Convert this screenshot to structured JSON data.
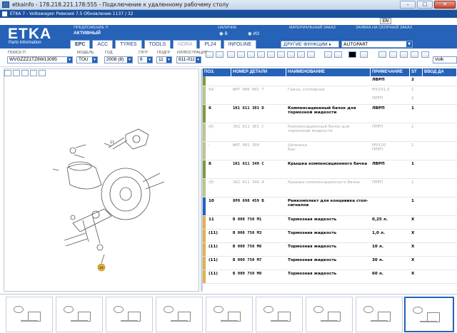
{
  "window": {
    "title": "etkainfo - 178.218.221.178:555 - Подключение к удаленному рабочему столу",
    "app_title": "ETKA 7 - Volkswagen Ревизия 7.5 Обновление 1137 / 32",
    "minimize_label": "–",
    "maximize_label": "□",
    "close_label": "✕",
    "language": "EN"
  },
  "header": {
    "logo": "ETKA",
    "logo_sub": "Parts Information",
    "offer_label": "ПРЕДЛОЖЕНИЕ П",
    "offer_value": "АКТИВНЫЙ",
    "availability_label": "НАЛИЧИЕ",
    "availability_b": "◉ В",
    "availability_iz": "◉ ИЗ",
    "material_order_label": "МАТЕРИАЛЬНЫЙ ЗАКАЗ",
    "warehouse_order_label": "ЗАЯВКА НА СБОРНЫЙ ЗАКАЗ",
    "tabs": [
      "EPC",
      "ACC",
      "TYRES",
      "TOOLS",
      "NORA",
      "PL24",
      "INFOLINE"
    ],
    "other_functions_label": "ДРУГИЕ ФУНКЦИИ ▸",
    "function_select_value": "AUTOPART"
  },
  "search": {
    "search_label": "ПОИСК П",
    "search_value": "WVGZZZ1TZ8W13095",
    "model_label": "МОДЕЛЬ",
    "model_value": "TOU",
    "year_label": "ГОД",
    "year_value": "2008 (8)",
    "group_label": "ГЛГР",
    "group_value": "6",
    "subgroup_label": "ПОДГР",
    "subgroup_value": "11",
    "illustration_label": "ИЛЛЮСТРАЦИЯ",
    "illustration_value": "611-011",
    "right_field_value": "Volk"
  },
  "table": {
    "columns": [
      "ПОЗ.",
      "НОМЕР ДЕТАЛИ",
      "НАИМЕНОВАНИЕ",
      "ПРИМЕЧАНИЕ",
      "ST",
      "ВВОД ДА"
    ],
    "rows": [
      {
        "pos": "",
        "part": "",
        "name": "",
        "note": "ЛВРП",
        "st": "2",
        "date": "",
        "style": "bold",
        "bar": "#7d9a3a"
      },
      {
        "pos": "5A",
        "part": "WHT 000 001 T",
        "name": "Гайка, стопорная",
        "note": "M10X1,5\n\nПРРП",
        "st": "1\n\n2",
        "date": "",
        "style": "gray",
        "bar": "#b9c78a"
      },
      {
        "pos": "6",
        "part": "1K1 611 301 D",
        "name": "Компенсационный бачок для тормозной жидкости",
        "note": "ЛВРП",
        "st": "1",
        "date": "",
        "style": "bold",
        "bar": "#7d9a3a"
      },
      {
        "pos": "(6)",
        "part": "1K2 611 301 C",
        "name": "Компенсационный бачок для тормозной жидкости",
        "note": "ПРРП",
        "st": "1",
        "date": "",
        "style": "gray",
        "bar": "#b9c78a"
      },
      {
        "pos": "-",
        "part": "WHT 001 399",
        "name": "Шпилька\nБак",
        "note": "M5X20\nПРРП",
        "st": "1",
        "date": "",
        "style": "gray",
        "bar": "#b9c78a"
      },
      {
        "pos": "8",
        "part": "1K1 611 349 C",
        "name": "Крышка компенсационного бачка",
        "note": "ЛВРП",
        "st": "1",
        "date": "",
        "style": "bold",
        "bar": "#7d9a3a"
      },
      {
        "pos": "(8)",
        "part": "1K2 611 349 A",
        "name": "Крышка компенсационного бачка",
        "note": "ПРРП",
        "st": "1",
        "date": "",
        "style": "gray",
        "bar": "#b9c78a"
      },
      {
        "pos": "10",
        "part": "8P0 698 459 B",
        "name": "Ремкомплект для концевика стоп-сигналов",
        "note": "",
        "st": "1",
        "date": "",
        "style": "bold",
        "bar": "#2562b8"
      },
      {
        "pos": "11",
        "part": "B   000 750 M1",
        "name": "Тормозная жидкость",
        "note": "0,25 л.",
        "st": "X",
        "date": "",
        "style": "bold",
        "bar": "#e0b04a"
      },
      {
        "pos": "(11)",
        "part": "B   000 750 M3",
        "name": "Тормозная жидкость",
        "note": "1,0 л.",
        "st": "X",
        "date": "",
        "style": "bold",
        "bar": "#e0b04a"
      },
      {
        "pos": "(11)",
        "part": "B   000 750 M6",
        "name": "Тормозная жидкость",
        "note": "10 л.",
        "st": "X",
        "date": "",
        "style": "bold",
        "bar": "#e0b04a"
      },
      {
        "pos": "(11)",
        "part": "B   000 750 M7",
        "name": "Тормозная жидкость",
        "note": "30 л.",
        "st": "X",
        "date": "",
        "style": "bold",
        "bar": "#e0b04a"
      },
      {
        "pos": "(11)",
        "part": "B   000 750 M9",
        "name": "Тормозная жидкость",
        "note": "60 л.",
        "st": "X",
        "date": "",
        "style": "bold",
        "bar": "#e0b04a"
      }
    ]
  },
  "illustration": {
    "callout_11": "11",
    "callout_10": "10"
  },
  "colors": {
    "brand_blue": "#2562b8",
    "title_blue": "#1a4f9c"
  }
}
